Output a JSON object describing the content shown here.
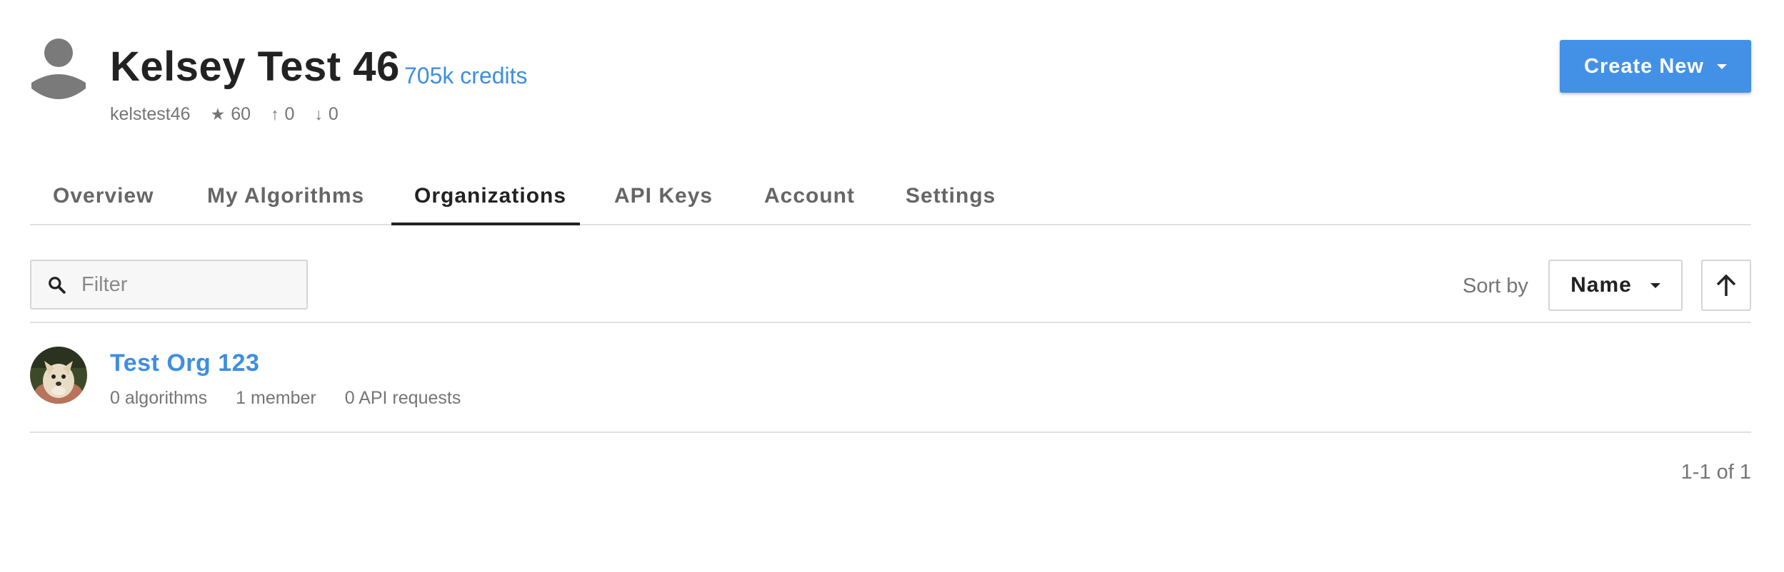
{
  "profile": {
    "name": "Kelsey Test 46",
    "credits": "705k credits",
    "username": "kelstest46",
    "stars": "60",
    "up": "0",
    "down": "0"
  },
  "header": {
    "create_label": "Create New"
  },
  "tabs": [
    {
      "label": "Overview",
      "active": false
    },
    {
      "label": "My Algorithms",
      "active": false
    },
    {
      "label": "Organizations",
      "active": true
    },
    {
      "label": "API Keys",
      "active": false
    },
    {
      "label": "Account",
      "active": false
    },
    {
      "label": "Settings",
      "active": false
    }
  ],
  "filter": {
    "placeholder": "Filter",
    "value": ""
  },
  "sort": {
    "label": "Sort by",
    "selected": "Name",
    "direction": "ascending"
  },
  "organizations": [
    {
      "name": "Test Org 123",
      "algorithms": "0 algorithms",
      "members": "1 member",
      "api_requests": "0 API requests"
    }
  ],
  "pagination": {
    "text": "1-1 of 1"
  },
  "colors": {
    "accent": "#4391e6",
    "link": "#3f8ee0",
    "muted": "#757575"
  }
}
